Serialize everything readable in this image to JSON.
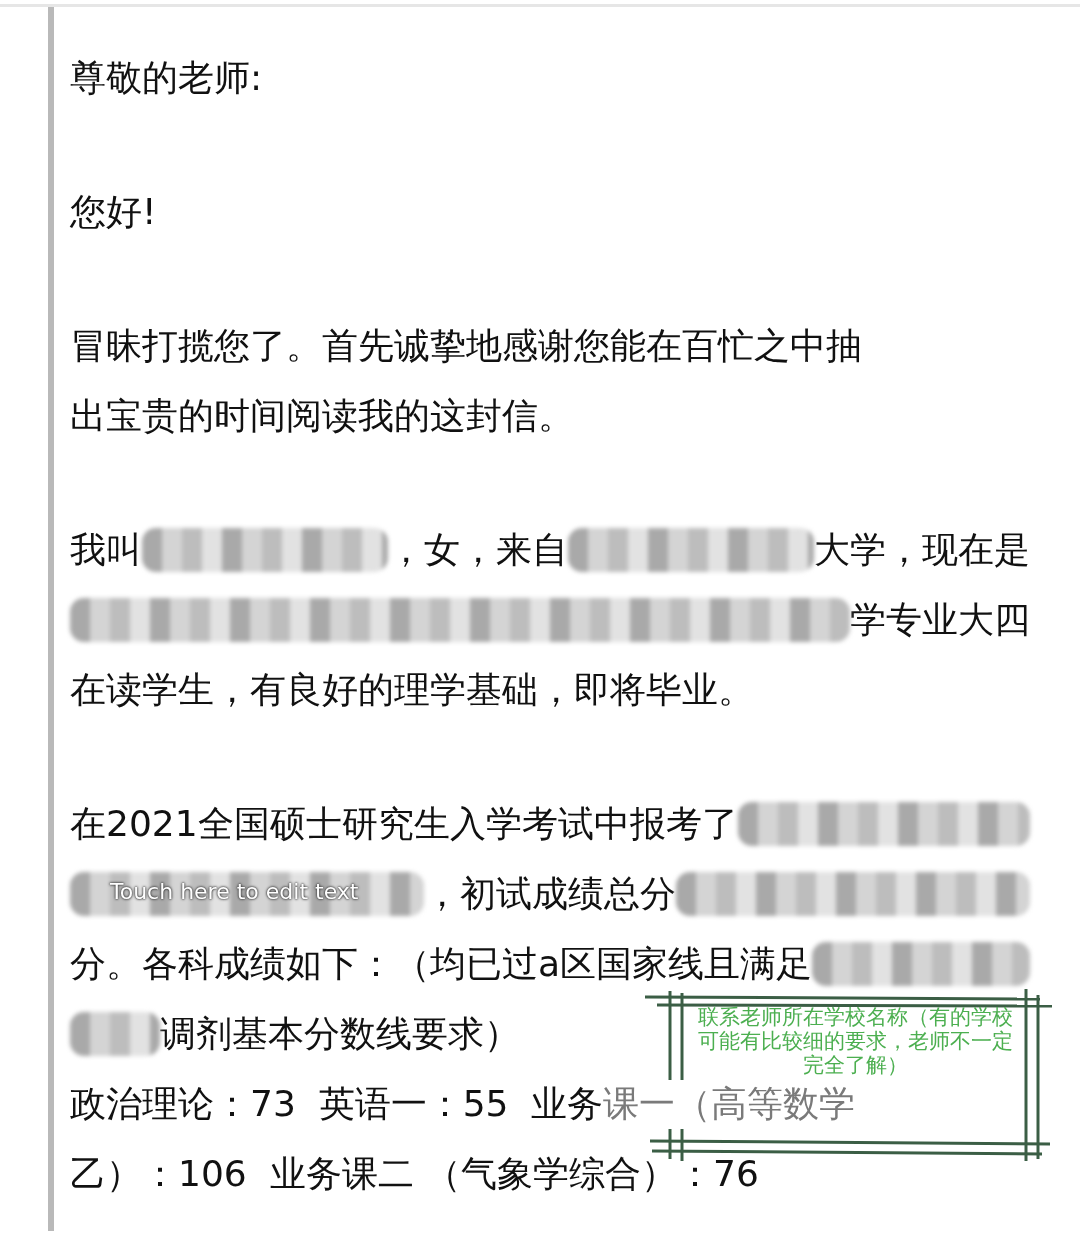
{
  "document": {
    "paragraphs": [
      {
        "lines": [
          [
            {
              "kind": "text",
              "text": "尊敬的老师:"
            }
          ]
        ]
      },
      {
        "lines": [
          [
            {
              "kind": "text",
              "text": "您好!"
            }
          ]
        ]
      },
      {
        "lines": [
          [
            {
              "kind": "text",
              "text": "冒昧打揽您了。首先诚挚地感谢您能在百忙之中抽"
            }
          ],
          [
            {
              "kind": "text",
              "text": "出宝贵的时间阅读我的这封信。"
            }
          ]
        ]
      },
      {
        "lines": [
          [
            {
              "kind": "text",
              "text": "我叫"
            },
            {
              "kind": "redacted"
            },
            {
              "kind": "text",
              "text": "，女，来自"
            },
            {
              "kind": "redacted"
            },
            {
              "kind": "text",
              "text": "大学，现在是"
            }
          ],
          [
            {
              "kind": "redacted"
            },
            {
              "kind": "text",
              "text": "学专业大四"
            }
          ],
          [
            {
              "kind": "text",
              "text": "在读学生，有良好的理学基础，即将毕业。"
            }
          ]
        ]
      },
      {
        "lines": [
          [
            {
              "kind": "text",
              "text": "在2021全国硕士研究生入学考试中报考了"
            },
            {
              "kind": "redacted"
            }
          ],
          [
            {
              "kind": "redacted"
            },
            {
              "kind": "text",
              "text": "，初试成绩总分"
            },
            {
              "kind": "redacted"
            }
          ],
          [
            {
              "kind": "text",
              "text": "分。各科成绩如下：（均已过a区国家线且满足"
            },
            {
              "kind": "redacted"
            }
          ],
          [
            {
              "kind": "redacted"
            },
            {
              "kind": "text",
              "text": "调剂基本分数线要求）"
            }
          ],
          [
            {
              "kind": "text",
              "text": "政治理论：73  英语一：55  业务"
            },
            {
              "kind": "faded",
              "text": "课一（高等数学"
            }
          ],
          [
            {
              "kind": "text",
              "text": "乙）：106  业务课二 （气象学综合）：76"
            }
          ]
        ]
      }
    ],
    "edit_hint": "Touch here to edit text"
  },
  "annotation": {
    "text": "联系老师所在学校名称（有的学校可能有比较细的要求，老师不一定完全了解）"
  }
}
